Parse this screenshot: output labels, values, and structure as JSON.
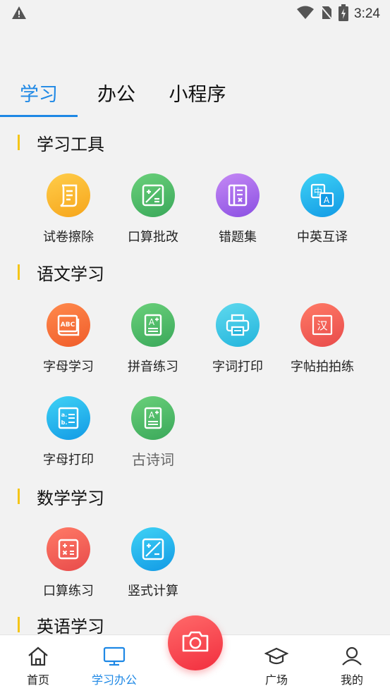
{
  "status_bar": {
    "time": "3:24",
    "icons": [
      "warning-icon",
      "wifi-icon",
      "no-sim-icon",
      "battery-charging-icon"
    ]
  },
  "tabs": [
    {
      "label": "学习",
      "active": true
    },
    {
      "label": "办公",
      "active": false
    },
    {
      "label": "小程序",
      "active": false
    }
  ],
  "sections": {
    "tools": {
      "title": "学习工具",
      "items": [
        {
          "label": "试卷擦除",
          "icon": "scroll-icon",
          "color": "#f9b52a"
        },
        {
          "label": "口算批改",
          "icon": "math-board-icon",
          "color": "#4cb865"
        },
        {
          "label": "错题集",
          "icon": "notebook-icon",
          "color": "#a56ae8"
        },
        {
          "label": "中英互译",
          "icon": "translate-icon",
          "color": "#1fb1ee"
        }
      ]
    },
    "chinese": {
      "title": "语文学习",
      "items": [
        {
          "label": "字母学习",
          "icon": "abc-book-icon",
          "color": "#f36b33"
        },
        {
          "label": "拼音练习",
          "icon": "pinyin-card-icon",
          "color": "#4cb865"
        },
        {
          "label": "字词打印",
          "icon": "printer-icon",
          "color": "#38c4e5"
        },
        {
          "label": "字帖拍拍练",
          "icon": "han-character-icon",
          "color": "#ef5a55"
        },
        {
          "label": "字母打印",
          "icon": "letter-list-icon",
          "color": "#1fb1ee"
        },
        {
          "label": "古诗词",
          "icon": "poem-card-icon",
          "color": "#4cb865"
        }
      ]
    },
    "math": {
      "title": "数学学习",
      "items": [
        {
          "label": "口算练习",
          "icon": "calculator-icon",
          "color": "#ef5a55"
        },
        {
          "label": "竖式计算",
          "icon": "vertical-calc-icon",
          "color": "#1fb1ee"
        }
      ]
    },
    "english": {
      "title": "英语学习"
    }
  },
  "bottom_nav": [
    {
      "label": "首页",
      "icon": "home-icon",
      "active": false
    },
    {
      "label": "学习办公",
      "icon": "monitor-icon",
      "active": true
    },
    {
      "label": "广场",
      "icon": "graduation-cap-icon",
      "active": false
    },
    {
      "label": "我的",
      "icon": "user-icon",
      "active": false
    }
  ],
  "camera_button": {
    "icon": "camera-icon"
  },
  "colors": {
    "accent": "#1e88e5",
    "section_bar": "#f5c518",
    "camera": "#f2404a"
  }
}
